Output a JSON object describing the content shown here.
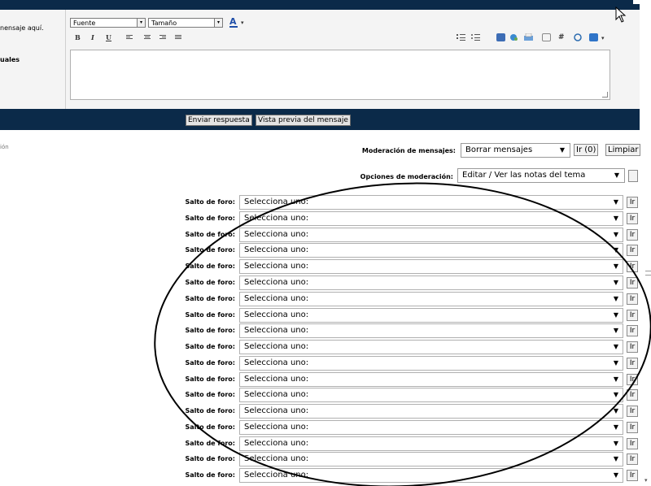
{
  "editor": {
    "left_hint": "nensaje aquí.",
    "left_emoticons": "uales",
    "font_select": "Fuente",
    "size_select": "Tamaño",
    "font_color_glyph": "A",
    "bold": "B",
    "italic": "I",
    "underline": "U"
  },
  "actions": {
    "send_reply": "Enviar respuesta",
    "preview": "Vista previa del mensaje"
  },
  "left_tiny": "ión",
  "moderation": {
    "messages_label": "Moderación de mensajes:",
    "messages_selected": "Borrar mensajes",
    "go_count": "Ir (0)",
    "clear": "Limpiar",
    "options_label": "Opciones de moderación:",
    "options_selected": "Editar / Ver las notas del tema"
  },
  "forum_jump": {
    "label": "Salto de foro:",
    "placeholder": "Selecciona uno:",
    "go": "Ir"
  },
  "colors": {
    "header": "#0b2a49",
    "panel": "#f4f4f4"
  }
}
